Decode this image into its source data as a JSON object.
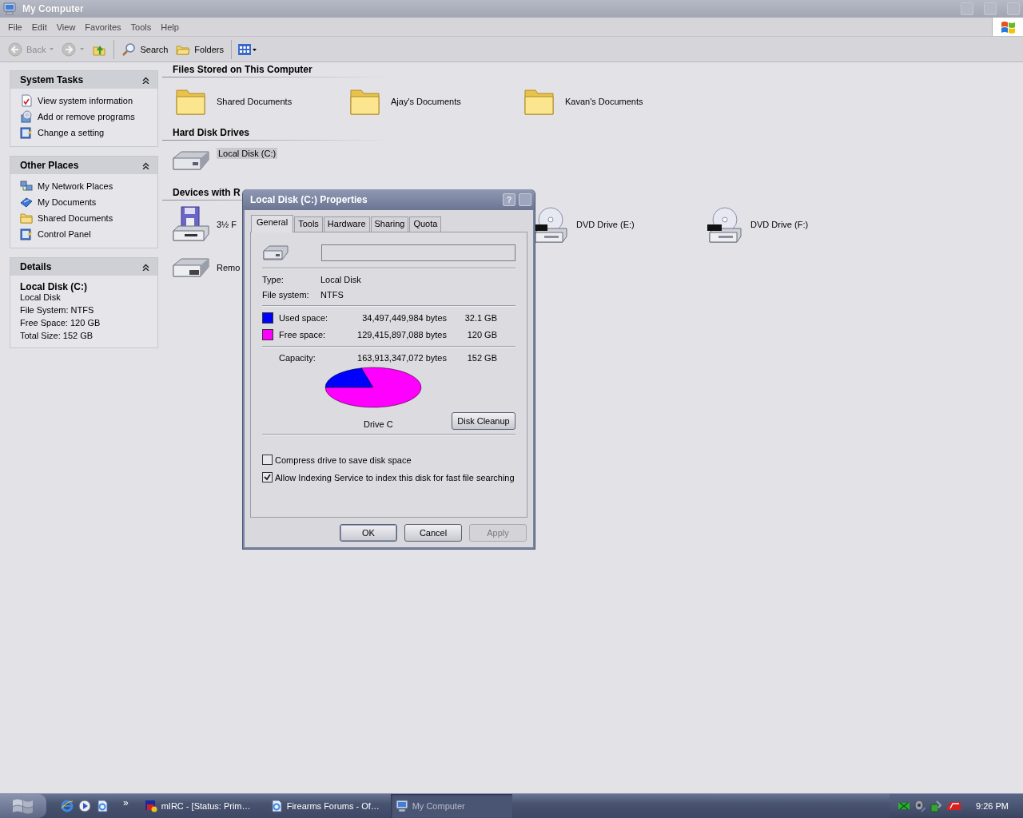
{
  "window": {
    "title": "My Computer"
  },
  "menu": [
    "File",
    "Edit",
    "View",
    "Favorites",
    "Tools",
    "Help"
  ],
  "toolbar": [
    {
      "kind": "back",
      "label": "Back",
      "disabled": true
    },
    {
      "kind": "forward",
      "disabled": true
    },
    {
      "kind": "up",
      "disabled": false
    },
    {
      "kind": "search",
      "label": "Search",
      "disabled": false
    },
    {
      "kind": "folders",
      "label": "Folders",
      "disabled": false
    },
    {
      "kind": "views",
      "disabled": false
    }
  ],
  "task_panels": [
    {
      "kind": "links",
      "title": "System Tasks",
      "expanded": true,
      "items": [
        {
          "kind": "sysinfo",
          "label": "View system information"
        },
        {
          "kind": "programs",
          "label": "Add or remove programs"
        },
        {
          "kind": "control",
          "label": "Change a setting"
        }
      ]
    },
    {
      "kind": "links",
      "title": "Other Places",
      "expanded": true,
      "items": [
        {
          "kind": "network",
          "label": "My Network Places"
        },
        {
          "kind": "mydocs",
          "label": "My Documents"
        },
        {
          "kind": "folder",
          "label": "Shared Documents"
        },
        {
          "kind": "control",
          "label": "Control Panel"
        }
      ]
    },
    {
      "kind": "details",
      "title": "Details",
      "expanded": true,
      "name": "Local Disk (C:)",
      "lines": [
        "Local Disk",
        "File System: NTFS",
        "Free Space: 120 GB",
        "Total Size: 152 GB"
      ]
    }
  ],
  "sections": [
    {
      "title": "Files Stored on This Computer",
      "items": [
        {
          "kind": "folder",
          "label": "Shared Documents",
          "selected": false
        },
        {
          "kind": "folder",
          "label": "Ajay's Documents",
          "selected": false
        },
        {
          "kind": "folder",
          "label": "Kavan's Documents",
          "selected": false
        }
      ]
    },
    {
      "title": "Hard Disk Drives",
      "items": [
        {
          "kind": "hdd",
          "label": "Local Disk (C:)",
          "selected": true
        }
      ]
    },
    {
      "title": "Devices with R",
      "items": [
        {
          "kind": "floppy",
          "label": "3½ F",
          "selected": false
        },
        {
          "kind": "dvd",
          "label": "DVD Drive (E:)",
          "selected": false
        },
        {
          "kind": "dvd",
          "label": "DVD Drive (F:)",
          "selected": false
        },
        {
          "kind": "removable",
          "label": "Remo",
          "selected": false
        }
      ]
    }
  ],
  "dialog": {
    "title": "Local Disk (C:) Properties",
    "help": "?",
    "tabs": [
      {
        "label": "General",
        "selected": true
      },
      {
        "label": "Tools",
        "selected": false
      },
      {
        "label": "Hardware",
        "selected": false
      },
      {
        "label": "Sharing",
        "selected": false
      },
      {
        "label": "Quota",
        "selected": false
      }
    ],
    "info": [
      {
        "label": "Type:",
        "value": "Local Disk"
      },
      {
        "label": "File system:",
        "value": "NTFS"
      }
    ],
    "space": [
      {
        "label": "Used space:",
        "bytes": "34,497,449,984 bytes",
        "size": "32.1 GB",
        "color": "#0000ff"
      },
      {
        "label": "Free space:",
        "bytes": "129,415,897,088 bytes",
        "size": "120 GB",
        "color": "#ff00ff"
      }
    ],
    "capacity": {
      "label": "Capacity:",
      "bytes": "163,913,347,072 bytes",
      "size": "152 GB"
    },
    "usage_pie": {
      "chart_data": {
        "type": "pie",
        "values": [
          21.1,
          78.9
        ]
      }
    },
    "drive_label": "Drive C",
    "cleanup_button": "Disk Cleanup",
    "options": [
      {
        "label": "Compress drive to save disk space",
        "checked": false
      },
      {
        "label": "Allow Indexing Service to index this disk for fast file searching",
        "checked": true
      }
    ],
    "buttons": [
      {
        "label": "OK",
        "disabled": false
      },
      {
        "label": "Cancel",
        "disabled": false
      },
      {
        "label": "Apply",
        "disabled": true
      }
    ]
  },
  "taskbar": {
    "quick_launch": [
      {
        "kind": "ie"
      },
      {
        "kind": "media"
      },
      {
        "kind": "iedoc"
      }
    ],
    "more": "»",
    "tasks": [
      {
        "kind": "mirc",
        "label": "mIRC - [Status: Prim…",
        "selected": false
      },
      {
        "kind": "doc",
        "label": "Firearms Forums - Of…",
        "selected": false
      },
      {
        "kind": "computer",
        "label": "My Computer",
        "selected": true
      }
    ],
    "tray": [
      {
        "kind": "network"
      },
      {
        "kind": "speaker"
      },
      {
        "kind": "usb"
      },
      {
        "kind": "card"
      }
    ],
    "clock": "9:26 PM"
  }
}
